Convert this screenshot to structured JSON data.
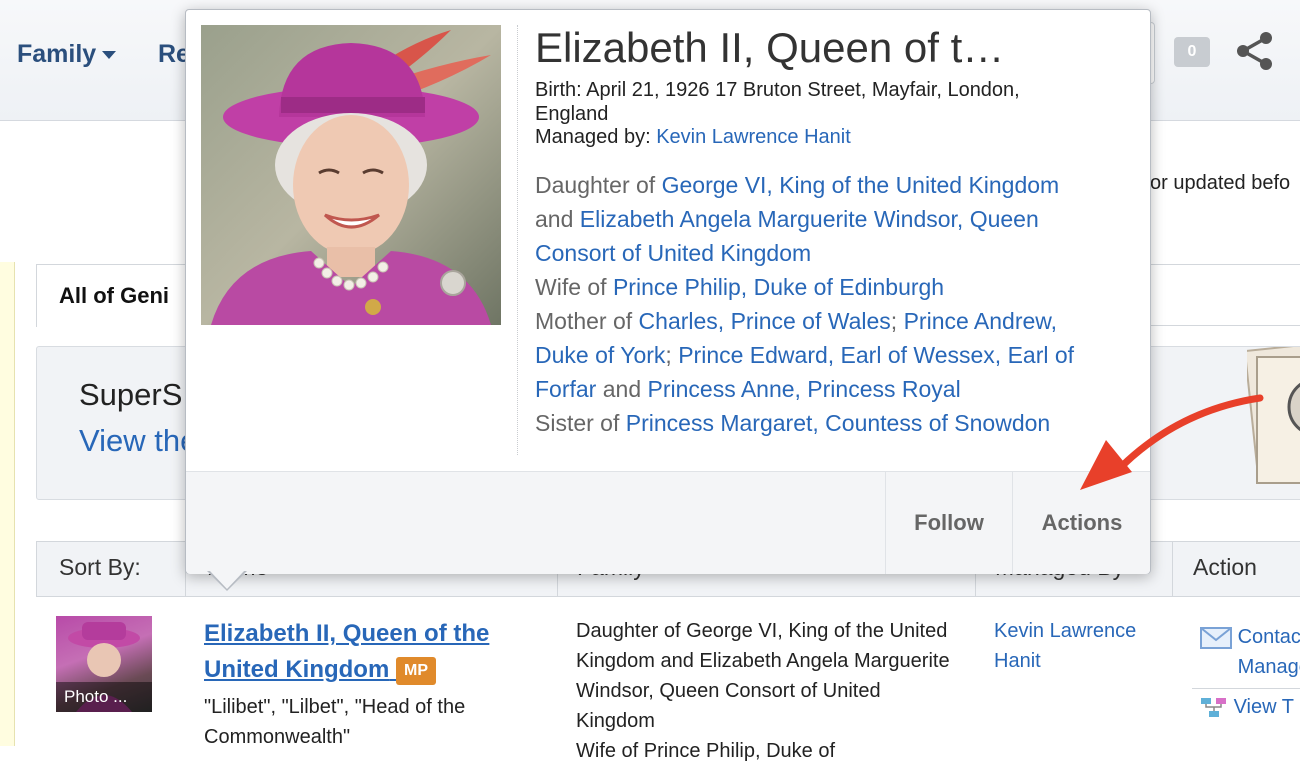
{
  "header": {
    "nav_family": "Family",
    "nav_re": "Re",
    "notification_count": "0",
    "share_icon": "share-icon"
  },
  "page": {
    "updated_text": "or updated befo",
    "tab_all_geni": "All of Geni",
    "supersearch_title": "SuperS",
    "supersearch_link": "View the"
  },
  "table": {
    "headers": [
      "Sort By:",
      "Name",
      "Family",
      "Managed By",
      "Action"
    ],
    "row": {
      "photo_caption": "Photo ...",
      "name": "Elizabeth II, Queen of the United Kingdom",
      "badge": "MP",
      "nicknames": "\"Lilibet\", \"Lilbet\", \"Head of the Commonwealth\"",
      "family": "Daughter of George VI, King of the United Kingdom and Elizabeth Angela Marguerite Windsor, Queen Consort of United Kingdom",
      "family_cut": "Wife of Prince Philip, Duke of",
      "managers": "Kevin Lawrence Hanit",
      "action_contact": "Contact Managers",
      "action_view": "View T"
    }
  },
  "hovercard": {
    "name": "Elizabeth II, Queen of t…",
    "birth": "Birth: April 21, 1926 17 Bruton Street, Mayfair, London, England",
    "managed_label": "Managed by:",
    "managed_name": "Kevin Lawrence Hanit",
    "daughter_of_label": "Daughter of",
    "father": "George VI, King of the United Kingdom",
    "and_1": "and",
    "mother": "Elizabeth Angela Marguerite Windsor, Queen Consort of United Kingdom",
    "wife_of_label": "Wife of",
    "husband": "Prince Philip, Duke of Edinburgh",
    "mother_of_label": "Mother of",
    "child_1": "Charles, Prince of Wales",
    "sep_1": ";",
    "child_2": "Prince Andrew, Duke of York",
    "sep_2": ";",
    "child_3": "Prince Edward, Earl of Wessex, Earl of Forfar",
    "and_2": "and",
    "child_4": "Princess Anne, Princess Royal",
    "sister_of_label": "Sister of",
    "sibling": "Princess Margaret, Countess of Snowdon",
    "follow_label": "Follow",
    "actions_label": "Actions"
  },
  "colors": {
    "link": "#2867b8",
    "nav": "#2b4f7d",
    "badge_mp": "#e08a2b",
    "annotation_arrow": "#e8402a"
  }
}
